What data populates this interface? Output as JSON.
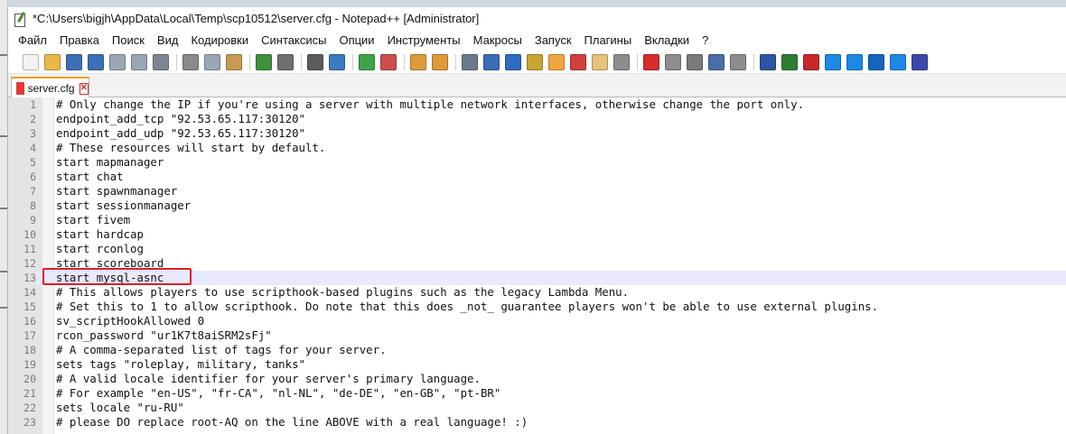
{
  "window": {
    "title": "*C:\\Users\\bigjh\\AppData\\Local\\Temp\\scp10512\\server.cfg - Notepad++ [Administrator]"
  },
  "menu": [
    "Файл",
    "Правка",
    "Поиск",
    "Вид",
    "Кодировки",
    "Синтаксисы",
    "Опции",
    "Инструменты",
    "Макросы",
    "Запуск",
    "Плагины",
    "Вкладки",
    "?"
  ],
  "tab": {
    "label": "server.cfg",
    "close_symbol": "✕"
  },
  "colors": {
    "highlight_box": "#e0192a",
    "current_line": "#e8e8ff",
    "tab_accent": "#f39c12"
  },
  "editor": {
    "current_line": 13,
    "lines": [
      "# Only change the IP if you're using a server with multiple network interfaces, otherwise change the port only.",
      "endpoint_add_tcp \"92.53.65.117:30120\"",
      "endpoint_add_udp \"92.53.65.117:30120\"",
      "# These resources will start by default.",
      "start mapmanager",
      "start chat",
      "start spawnmanager",
      "start sessionmanager",
      "start fivem",
      "start hardcap",
      "start rconlog",
      "start scoreboard",
      "start mysql-asnc",
      "# This allows players to use scripthook-based plugins such as the legacy Lambda Menu.",
      "# Set this to 1 to allow scripthook. Do note that this does _not_ guarantee players won't be able to use external plugins.",
      "sv_scriptHookAllowed 0",
      "rcon_password \"ur1K7t8aiSRM2sFj\"",
      "# A comma-separated list of tags for your server.",
      "sets tags \"roleplay, military, tanks\"",
      "# A valid locale identifier for your server's primary language.",
      "# For example \"en-US\", \"fr-CA\", \"nl-NL\", \"de-DE\", \"en-GB\", \"pt-BR\"",
      "sets locale \"ru-RU\"",
      "# please DO replace root-AQ on the line ABOVE with a real language! :)"
    ]
  },
  "toolbar_icons": [
    {
      "name": "new-file-icon",
      "color": "#f3f3f3"
    },
    {
      "name": "open-file-icon",
      "color": "#e8b84a"
    },
    {
      "name": "save-icon",
      "color": "#3c6fb6"
    },
    {
      "name": "save-all-icon",
      "color": "#3c6fb6"
    },
    {
      "name": "close-icon",
      "color": "#9aa6b3"
    },
    {
      "name": "close-all-icon",
      "color": "#9aa6b3"
    },
    {
      "name": "print-icon",
      "color": "#7d8793"
    },
    {
      "sep": true
    },
    {
      "name": "cut-icon",
      "color": "#8a8a8a"
    },
    {
      "name": "copy-icon",
      "color": "#9aa6b3"
    },
    {
      "name": "paste-icon",
      "color": "#c99b52"
    },
    {
      "sep": true
    },
    {
      "name": "undo-icon",
      "color": "#3f8f3f"
    },
    {
      "name": "redo-icon",
      "color": "#707070"
    },
    {
      "sep": true
    },
    {
      "name": "find-icon",
      "color": "#5c5c5c"
    },
    {
      "name": "replace-icon",
      "color": "#3b7bbf"
    },
    {
      "sep": true
    },
    {
      "name": "zoom-in-icon",
      "color": "#3fa34a"
    },
    {
      "name": "zoom-out-icon",
      "color": "#cc4d4d"
    },
    {
      "sep": true
    },
    {
      "name": "sync-vertical-icon",
      "color": "#e09a3b"
    },
    {
      "name": "sync-horizontal-icon",
      "color": "#e09a3b"
    },
    {
      "sep": true
    },
    {
      "name": "word-wrap-icon",
      "color": "#6b7a8a"
    },
    {
      "name": "show-all-chars-icon",
      "color": "#3b6bb6"
    },
    {
      "name": "indent-guide-icon",
      "color": "#2f6bc3"
    },
    {
      "name": "user-language-icon",
      "color": "#c7a535"
    },
    {
      "name": "doc-map-icon",
      "color": "#f0a640"
    },
    {
      "name": "function-list-icon",
      "color": "#d23f3f"
    },
    {
      "name": "folder-workspace-icon",
      "color": "#e6c27a"
    },
    {
      "name": "monitoring-icon",
      "color": "#8d8d8d"
    },
    {
      "sep": true
    },
    {
      "name": "record-macro-icon",
      "color": "#d82b2b"
    },
    {
      "name": "stop-record-icon",
      "color": "#8d8d8d"
    },
    {
      "name": "play-macro-icon",
      "color": "#7a7a7a"
    },
    {
      "name": "run-macro-multiple-icon",
      "color": "#4b6ea9"
    },
    {
      "name": "save-macro-icon",
      "color": "#8d8d8d"
    },
    {
      "sep": true
    },
    {
      "name": "plugin-icon-1",
      "color": "#2b56a3"
    },
    {
      "name": "plugin-icon-2",
      "color": "#2e7d32"
    },
    {
      "name": "plugin-icon-3",
      "color": "#c62828"
    },
    {
      "name": "plugin-icon-4",
      "color": "#1e88e5"
    },
    {
      "name": "plugin-icon-5",
      "color": "#1e88e5"
    },
    {
      "name": "plugin-icon-6",
      "color": "#1565c0"
    },
    {
      "name": "plugin-icon-7",
      "color": "#1e88e5"
    },
    {
      "name": "plugin-icon-8",
      "color": "#3949ab"
    }
  ]
}
